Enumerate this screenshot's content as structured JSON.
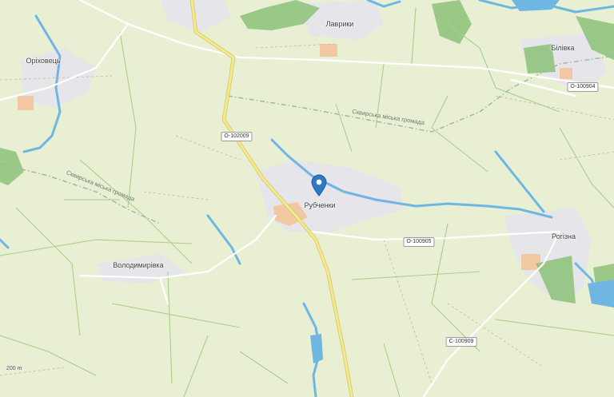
{
  "map": {
    "colors": {
      "land": "#e8efd2",
      "field_border": "#a9cf87",
      "water": "#6fb6e3",
      "forest": "#8cc27a",
      "settlement": "#e7e7ea",
      "main_road": "#f3e98f",
      "road_casing": "#d8c65a",
      "minor_road": "#ffffff",
      "pin": "#2f78c4",
      "industrial": "#f2c8a2"
    },
    "places": [
      {
        "id": "lavryky",
        "name": "Лаврики"
      },
      {
        "id": "orikhovets",
        "name": "Оріховець"
      },
      {
        "id": "bilivka",
        "name": "Білівка"
      },
      {
        "id": "rubchenky",
        "name": "Рубченки"
      },
      {
        "id": "volodymyrivka",
        "name": "Володимирівка"
      },
      {
        "id": "rohizna",
        "name": "Рогізна"
      }
    ],
    "roads": [
      {
        "id": "r1",
        "ref": "О-102009"
      },
      {
        "id": "r2",
        "ref": "О-100904"
      },
      {
        "id": "r3",
        "ref": "О-100905"
      },
      {
        "id": "r4",
        "ref": "С-100909"
      }
    ],
    "boundaries": [
      {
        "id": "b1",
        "label": "Сквирська міська громада"
      },
      {
        "id": "b2",
        "label": "Сквирська міська громада"
      }
    ],
    "scale_label": "200 m",
    "marker": {
      "icon": "location-pin-icon"
    }
  }
}
